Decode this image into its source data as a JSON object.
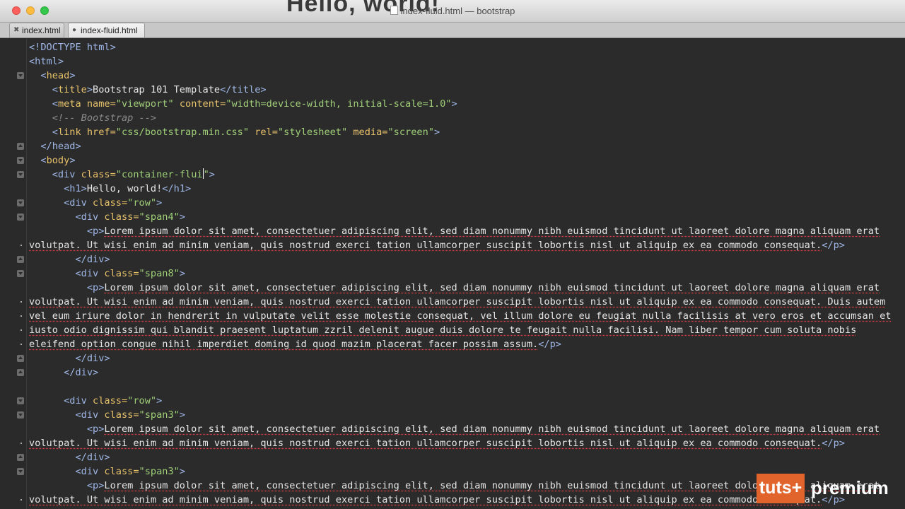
{
  "window": {
    "title": "index-fluid.html — bootstrap",
    "background_heading": "Hello, world!"
  },
  "tabs": [
    {
      "label": "index.html",
      "icon": "close-icon",
      "active": false
    },
    {
      "label": "index-fluid.html",
      "icon": "modified-dot-icon",
      "active": true
    }
  ],
  "editor": {
    "caret_line": 10,
    "lines": [
      {
        "fold": null,
        "cont": false,
        "segs": [
          [
            "tg",
            "<!DOCTYPE html>"
          ]
        ]
      },
      {
        "fold": null,
        "cont": false,
        "segs": [
          [
            "tg",
            "<html>"
          ]
        ]
      },
      {
        "fold": "open",
        "cont": false,
        "segs": [
          [
            "txt",
            "  "
          ],
          [
            "tg",
            "<"
          ],
          [
            "tn",
            "head"
          ],
          [
            "tg",
            ">"
          ]
        ]
      },
      {
        "fold": null,
        "cont": false,
        "segs": [
          [
            "txt",
            "    "
          ],
          [
            "tg",
            "<"
          ],
          [
            "tn",
            "title"
          ],
          [
            "tg",
            ">"
          ],
          [
            "txt",
            "Bootstrap 101 Template"
          ],
          [
            "tg",
            "</title>"
          ]
        ]
      },
      {
        "fold": null,
        "cont": false,
        "segs": [
          [
            "txt",
            "    "
          ],
          [
            "tg",
            "<"
          ],
          [
            "tn",
            "meta"
          ],
          [
            "at",
            " name="
          ],
          [
            "av",
            "\"viewport\""
          ],
          [
            "at",
            " content="
          ],
          [
            "av",
            "\"width=device-width, initial-scale=1.0\""
          ],
          [
            "tg",
            ">"
          ]
        ]
      },
      {
        "fold": null,
        "cont": false,
        "segs": [
          [
            "txt",
            "    "
          ],
          [
            "cm",
            "<!-- Bootstrap -->"
          ]
        ]
      },
      {
        "fold": null,
        "cont": false,
        "segs": [
          [
            "txt",
            "    "
          ],
          [
            "tg",
            "<"
          ],
          [
            "tn",
            "link"
          ],
          [
            "at",
            " href="
          ],
          [
            "av",
            "\"css/bootstrap.min.css\""
          ],
          [
            "at",
            " rel="
          ],
          [
            "av",
            "\"stylesheet\""
          ],
          [
            "at",
            " media="
          ],
          [
            "av",
            "\"screen\""
          ],
          [
            "tg",
            ">"
          ]
        ]
      },
      {
        "fold": "close",
        "cont": false,
        "segs": [
          [
            "txt",
            "  "
          ],
          [
            "tg",
            "</head>"
          ]
        ]
      },
      {
        "fold": "open",
        "cont": false,
        "segs": [
          [
            "txt",
            "  "
          ],
          [
            "tg",
            "<"
          ],
          [
            "tn",
            "body"
          ],
          [
            "tg",
            ">"
          ]
        ]
      },
      {
        "fold": "open",
        "cont": false,
        "segs": [
          [
            "txt",
            "    "
          ],
          [
            "tg",
            "<div"
          ],
          [
            "at",
            " class="
          ],
          [
            "av",
            "\"container-flui"
          ],
          [
            "caret",
            ""
          ],
          [
            "av",
            "\""
          ],
          [
            "tg",
            ">"
          ]
        ]
      },
      {
        "fold": null,
        "cont": false,
        "segs": [
          [
            "txt",
            "      "
          ],
          [
            "tg",
            "<h1>"
          ],
          [
            "txt",
            "Hello, world!"
          ],
          [
            "tg",
            "</h1>"
          ]
        ]
      },
      {
        "fold": "open",
        "cont": false,
        "segs": [
          [
            "txt",
            "      "
          ],
          [
            "tg",
            "<div"
          ],
          [
            "at",
            " class="
          ],
          [
            "av",
            "\"row\""
          ],
          [
            "tg",
            ">"
          ]
        ]
      },
      {
        "fold": "open",
        "cont": false,
        "segs": [
          [
            "txt",
            "        "
          ],
          [
            "tg",
            "<div"
          ],
          [
            "at",
            " class="
          ],
          [
            "av",
            "\"span4\""
          ],
          [
            "tg",
            ">"
          ]
        ]
      },
      {
        "fold": null,
        "cont": false,
        "segs": [
          [
            "txt",
            "          "
          ],
          [
            "tg",
            "<p>"
          ],
          [
            "sp",
            "Lorem ipsum dolor sit amet, consectetuer adipiscing elit, sed diam nonummy nibh euismod tincidunt ut laoreet dolore magna aliquam erat"
          ]
        ]
      },
      {
        "fold": null,
        "cont": true,
        "segs": [
          [
            "sp",
            "volutpat. Ut wisi enim ad minim veniam, quis nostrud exerci tation ullamcorper suscipit lobortis nisl ut aliquip ex ea commodo consequat."
          ],
          [
            "tg",
            "</p>"
          ]
        ]
      },
      {
        "fold": "close",
        "cont": false,
        "segs": [
          [
            "txt",
            "        "
          ],
          [
            "tg",
            "</div>"
          ]
        ]
      },
      {
        "fold": "open",
        "cont": false,
        "segs": [
          [
            "txt",
            "        "
          ],
          [
            "tg",
            "<div"
          ],
          [
            "at",
            " class="
          ],
          [
            "av",
            "\"span8\""
          ],
          [
            "tg",
            ">"
          ]
        ]
      },
      {
        "fold": null,
        "cont": false,
        "segs": [
          [
            "txt",
            "          "
          ],
          [
            "tg",
            "<p>"
          ],
          [
            "sp",
            "Lorem ipsum dolor sit amet, consectetuer adipiscing elit, sed diam nonummy nibh euismod tincidunt ut laoreet dolore magna aliquam erat"
          ]
        ]
      },
      {
        "fold": null,
        "cont": true,
        "segs": [
          [
            "sp",
            "volutpat. Ut wisi enim ad minim veniam, quis nostrud exerci tation ullamcorper suscipit lobortis nisl ut aliquip ex ea commodo consequat. Duis autem"
          ]
        ]
      },
      {
        "fold": null,
        "cont": true,
        "segs": [
          [
            "sp",
            "vel eum iriure dolor in hendrerit in vulputate velit esse molestie consequat, vel illum dolore eu feugiat nulla facilisis at vero eros et accumsan et"
          ]
        ]
      },
      {
        "fold": null,
        "cont": true,
        "segs": [
          [
            "sp",
            "iusto odio dignissim qui blandit praesent luptatum zzril delenit augue duis dolore te feugait nulla facilisi. Nam liber tempor cum soluta nobis"
          ]
        ]
      },
      {
        "fold": null,
        "cont": true,
        "segs": [
          [
            "sp",
            "eleifend option congue nihil imperdiet doming id quod mazim placerat facer possim assum."
          ],
          [
            "tg",
            "</p>"
          ]
        ]
      },
      {
        "fold": "close",
        "cont": false,
        "segs": [
          [
            "txt",
            "        "
          ],
          [
            "tg",
            "</div>"
          ]
        ]
      },
      {
        "fold": "close",
        "cont": false,
        "segs": [
          [
            "txt",
            "      "
          ],
          [
            "tg",
            "</div>"
          ]
        ]
      },
      {
        "fold": null,
        "cont": false,
        "segs": [
          [
            "txt",
            ""
          ]
        ]
      },
      {
        "fold": "open",
        "cont": false,
        "segs": [
          [
            "txt",
            "      "
          ],
          [
            "tg",
            "<div"
          ],
          [
            "at",
            " class="
          ],
          [
            "av",
            "\"row\""
          ],
          [
            "tg",
            ">"
          ]
        ]
      },
      {
        "fold": "open",
        "cont": false,
        "segs": [
          [
            "txt",
            "        "
          ],
          [
            "tg",
            "<div"
          ],
          [
            "at",
            " class="
          ],
          [
            "av",
            "\"span3\""
          ],
          [
            "tg",
            ">"
          ]
        ]
      },
      {
        "fold": null,
        "cont": false,
        "segs": [
          [
            "txt",
            "          "
          ],
          [
            "tg",
            "<p>"
          ],
          [
            "sp",
            "Lorem ipsum dolor sit amet, consectetuer adipiscing elit, sed diam nonummy nibh euismod tincidunt ut laoreet dolore magna aliquam erat"
          ]
        ]
      },
      {
        "fold": null,
        "cont": true,
        "segs": [
          [
            "sp",
            "volutpat. Ut wisi enim ad minim veniam, quis nostrud exerci tation ullamcorper suscipit lobortis nisl ut aliquip ex ea commodo consequat."
          ],
          [
            "tg",
            "</p>"
          ]
        ]
      },
      {
        "fold": "close",
        "cont": false,
        "segs": [
          [
            "txt",
            "        "
          ],
          [
            "tg",
            "</div>"
          ]
        ]
      },
      {
        "fold": "open",
        "cont": false,
        "segs": [
          [
            "txt",
            "        "
          ],
          [
            "tg",
            "<div"
          ],
          [
            "at",
            " class="
          ],
          [
            "av",
            "\"span3\""
          ],
          [
            "tg",
            ">"
          ]
        ]
      },
      {
        "fold": null,
        "cont": false,
        "segs": [
          [
            "txt",
            "          "
          ],
          [
            "tg",
            "<p>"
          ],
          [
            "sp",
            "Lorem ipsum dolor sit amet, consectetuer adipiscing elit, sed diam nonummy nibh euismod tincidunt ut laoreet dolore magna aliquam erat"
          ]
        ]
      },
      {
        "fold": null,
        "cont": true,
        "segs": [
          [
            "sp",
            "volutpat. Ut wisi enim ad minim veniam, quis nostrud exerci tation ullamcorper suscipit lobortis nisl ut aliquip ex ea commodo consequat."
          ],
          [
            "tg",
            "</p>"
          ]
        ]
      }
    ]
  },
  "watermark": {
    "box": "tuts+",
    "word": "premium"
  }
}
